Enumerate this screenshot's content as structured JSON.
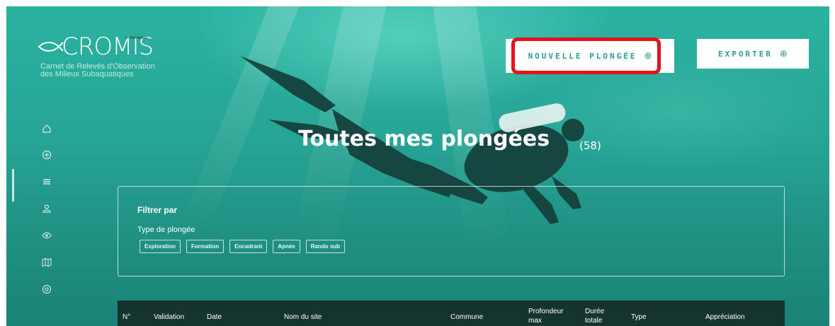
{
  "logo": {
    "name": "CROMIS",
    "tag": "by Fédération",
    "subtitle_line1": "Carnet de Relevés d'Observation",
    "subtitle_line2": "des Milieux Subaquatiques"
  },
  "header": {
    "new_dive_label": "NOUVELLE PLONGÉE",
    "new_dive_icon": "plus-circle-icon",
    "export_label": "EXPORTER",
    "export_icon": "plus-circle-icon"
  },
  "sidebar": {
    "items": [
      {
        "icon": "home-icon"
      },
      {
        "icon": "plus-circle-icon"
      },
      {
        "icon": "list-icon",
        "active": true
      },
      {
        "icon": "user-icon"
      },
      {
        "icon": "eye-icon"
      },
      {
        "icon": "map-icon"
      },
      {
        "icon": "location-pin-icon"
      }
    ]
  },
  "page": {
    "title": "Toutes mes plongées",
    "count": "(58)"
  },
  "filter": {
    "title": "Filtrer par",
    "type_label": "Type de plongée",
    "chips": [
      "Exploration",
      "Formation",
      "Encadrant",
      "Apnée",
      "Rando sub"
    ]
  },
  "table": {
    "headers": [
      "N°",
      "Validation",
      "Date",
      "Nom du site",
      "Commune",
      "Profondeur max",
      "Durée totale",
      "Type",
      "Appréciation"
    ]
  },
  "colors": {
    "accent": "#2a9f92",
    "background": "#27a595",
    "highlight": "#e8101a",
    "table_header": "#15342f"
  }
}
